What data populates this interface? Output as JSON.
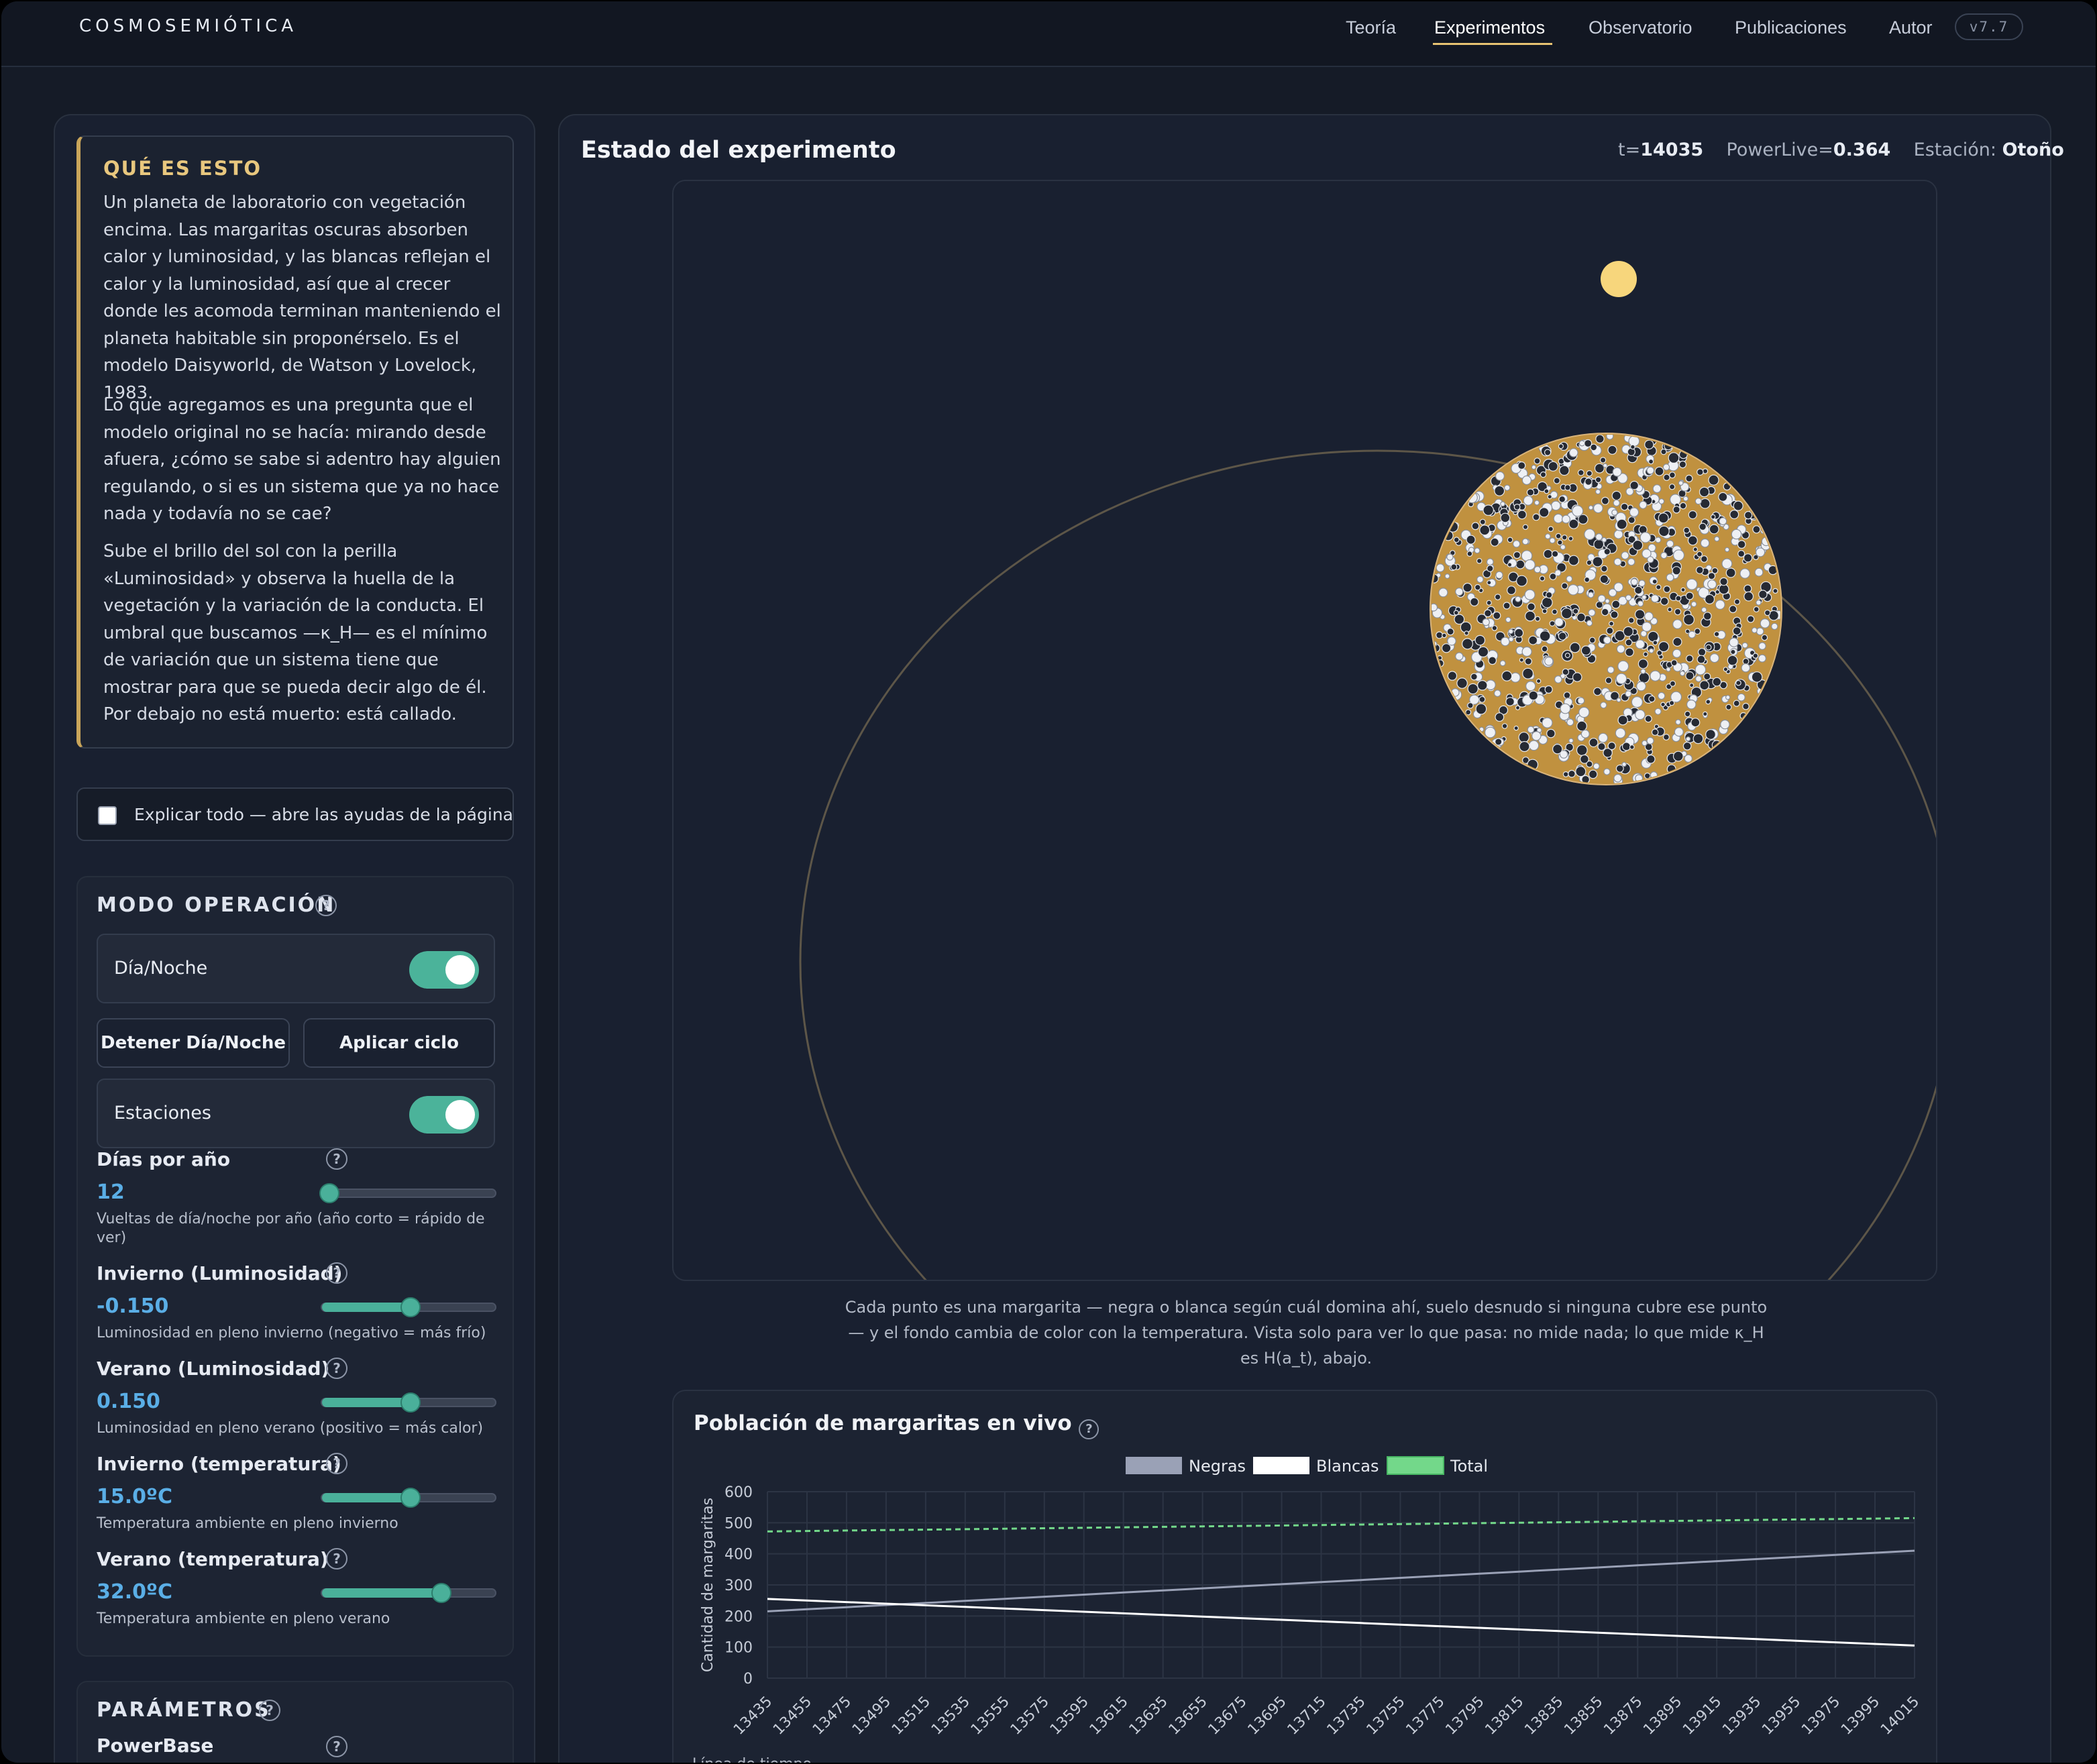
{
  "nav": {
    "brand": "COSMOSEMIÓTICA",
    "links": [
      "Teoría",
      "Experimentos",
      "Observatorio",
      "Publicaciones",
      "Autor"
    ],
    "active": "Experimentos",
    "version": "v7.7"
  },
  "about": {
    "title": "QUÉ ES ESTO",
    "p1": "Un planeta de laboratorio con vegetación encima. Las margaritas oscuras absorben calor y luminosidad, y las blancas reflejan el calor y la luminosidad, así que al crecer donde les acomoda terminan manteniendo el planeta habitable sin proponérselo. Es el modelo Daisyworld, de Watson y Lovelock, 1983.",
    "p2": "Lo que agregamos es una pregunta que el modelo original no se hacía: mirando desde afuera, ¿cómo se sabe si adentro hay alguien regulando, o si es un sistema que ya no hace nada y todavía no se cae?",
    "p3": "Sube el brillo del sol con la perilla «Luminosidad» y observa la huella de la vegetación y la variación de la conducta. El umbral que buscamos —κ_H— es el mínimo de variación que un sistema tiene que mostrar para que se pueda decir algo de él. Por debajo no está muerto: está callado."
  },
  "explain_all": {
    "label": "Explicar todo — abre las ayudas de la página",
    "checked": false
  },
  "mode": {
    "title": "MODO OPERACIÓN",
    "help": "?",
    "day_night": {
      "label": "Día/Noche",
      "on": true
    },
    "stop_button": "Detener Día/Noche",
    "apply_button": "Aplicar ciclo",
    "seasons": {
      "label": "Estaciones",
      "on": true
    },
    "params": [
      {
        "name": "Días por año",
        "value": "12",
        "desc": "Vueltas de día/noche por año (año corto = rápido de ver)",
        "fraction": 0.03
      },
      {
        "name": "Invierno (Luminosidad)",
        "value": "-0.150",
        "desc": "Luminosidad en pleno invierno (negativo = más frío)",
        "fraction": 0.5
      },
      {
        "name": "Verano (Luminosidad)",
        "value": "0.150",
        "desc": "Luminosidad en pleno verano (positivo = más calor)",
        "fraction": 0.5
      },
      {
        "name": "Invierno (temperatura)",
        "value": "15.0ºC",
        "desc": "Temperatura ambiente en pleno invierno",
        "fraction": 0.5
      },
      {
        "name": "Verano (temperatura)",
        "value": "32.0ºC",
        "desc": "Temperatura ambiente en pleno verano",
        "fraction": 0.68
      }
    ]
  },
  "parameters": {
    "title": "PARÁMETROS",
    "first_param": "PowerBase"
  },
  "main": {
    "title": "Estado del experimento",
    "t_label": "t=",
    "t_value": "14035",
    "power_label": "PowerLive=",
    "power_value": "0.364",
    "season_label": "Estación: ",
    "season_value": "Otoño",
    "caption": "Cada punto es una margarita — negra o blanca según cuál domina ahí, suelo desnudo si ninguna cubre ese punto — y el fondo cambia de color con la temperatura. Vista solo para ver lo que pasa: no mide nada; lo que mide κ_H es H(a_t), abajo."
  },
  "colors": {
    "soil": "#c0913f",
    "sun": "#f7d67c",
    "orbit": "#5d5648",
    "black_series": "#9aa1b6",
    "white_series": "#ffffff",
    "total_series": "#73d88a"
  },
  "chart_title": "Población de margaritas en vivo",
  "chart_data": {
    "type": "line",
    "title": "",
    "ylabel": "Cantidad de margaritas",
    "xlabel": "",
    "ylim": [
      0,
      600
    ],
    "yticks": [
      0,
      100,
      200,
      300,
      400,
      500,
      600
    ],
    "legend": "top-center",
    "grid": true,
    "x": [
      13435,
      13455,
      13475,
      13495,
      13515,
      13535,
      13555,
      13575,
      13595,
      13615,
      13635,
      13655,
      13675,
      13695,
      13715,
      13735,
      13755,
      13775,
      13795,
      13815,
      13835,
      13855,
      13875,
      13895,
      13915,
      13935,
      13955,
      13975,
      13995,
      14015
    ],
    "series": [
      {
        "name": "Negras",
        "start": 215,
        "end": 410
      },
      {
        "name": "Blancas",
        "start": 255,
        "end": 105
      },
      {
        "name": "Total",
        "start": 472,
        "end": 515
      }
    ]
  },
  "bottom_hint": "Línea de tiempo"
}
